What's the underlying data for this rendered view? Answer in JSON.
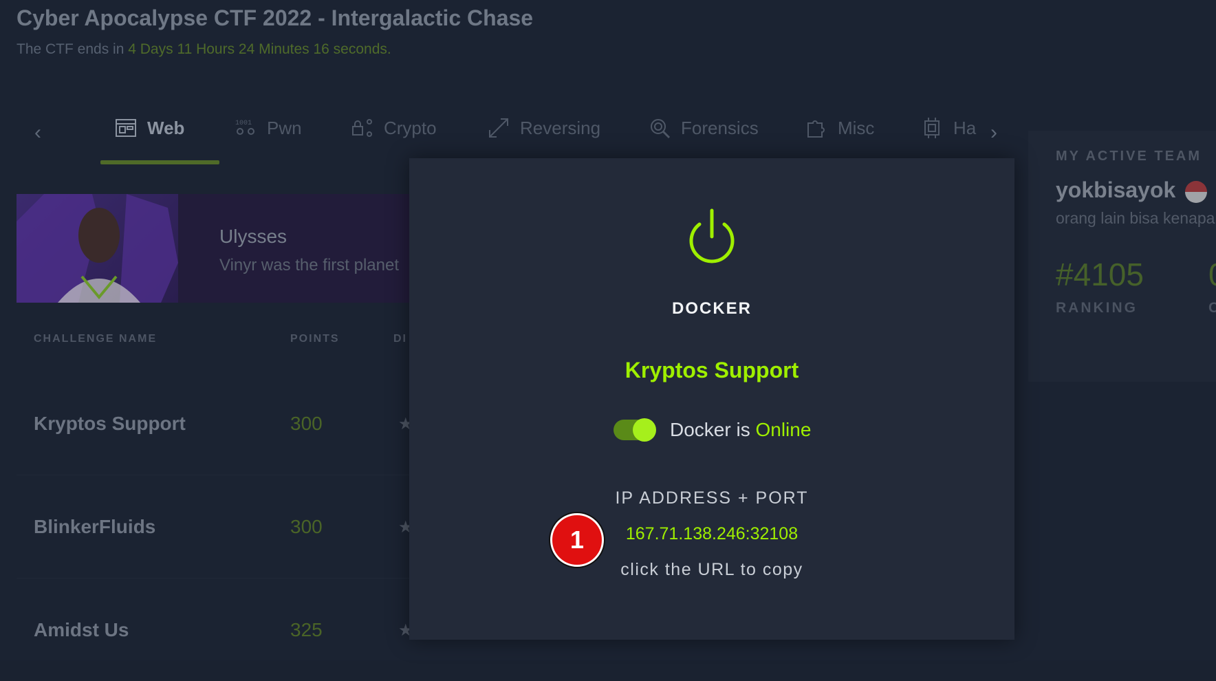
{
  "header": {
    "title": "Cyber Apocalypse CTF 2022 - Intergalactic Chase",
    "countdown_prefix": "The CTF ends in",
    "countdown_time": "4 Days 11 Hours 24 Minutes 16 seconds."
  },
  "tabs": [
    {
      "label": "Web",
      "icon": "web-icon",
      "active": true
    },
    {
      "label": "Pwn",
      "icon": "binary-icon"
    },
    {
      "label": "Crypto",
      "icon": "crypto-icon"
    },
    {
      "label": "Reversing",
      "icon": "reversing-icon"
    },
    {
      "label": "Forensics",
      "icon": "fingerprint-icon"
    },
    {
      "label": "Misc",
      "icon": "puzzle-icon"
    },
    {
      "label": "Ha",
      "icon": "chip-icon"
    }
  ],
  "banner": {
    "name": "Ulysses",
    "description": "Vinyr was the first planet"
  },
  "table": {
    "columns": [
      "CHALLENGE NAME",
      "POINTS",
      "DI"
    ],
    "rows": [
      {
        "name": "Kryptos Support",
        "points": "300"
      },
      {
        "name": "BlinkerFluids",
        "points": "300"
      },
      {
        "name": "Amidst Us",
        "points": "325"
      }
    ]
  },
  "team": {
    "heading": "MY ACTIVE TEAM",
    "name": "yokbisayok",
    "motto": "orang lain bisa kenapa",
    "ranking": "#4105",
    "ranking_label": "RANKING",
    "extra_value": "0",
    "extra_label": "C"
  },
  "modal": {
    "title": "DOCKER",
    "challenge": "Kryptos Support",
    "status_prefix": "Docker is",
    "status_value": "Online",
    "ip_heading": "IP ADDRESS + PORT",
    "ip": "167.71.138.246:32108",
    "copy_hint": "click the URL to copy",
    "marker": "1"
  },
  "colors": {
    "accent": "#9fef00",
    "background": "#1b2332",
    "modal": "#232a39",
    "marker": "#e01010"
  }
}
